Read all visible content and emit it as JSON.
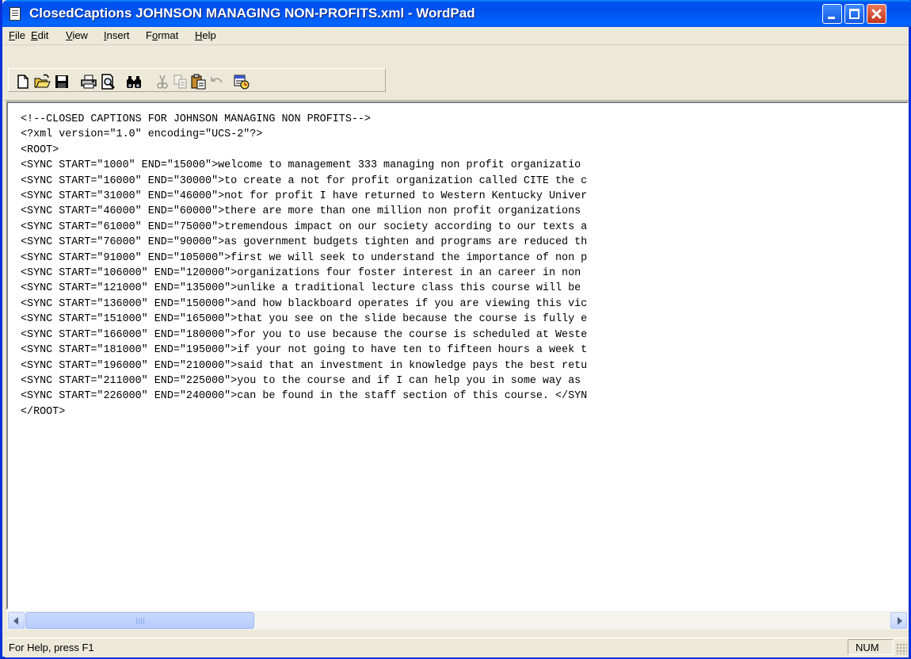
{
  "window": {
    "title": "ClosedCaptions JOHNSON MANAGING NON-PROFITS.xml - WordPad",
    "app_icon": "wordpad-document-icon",
    "controls": [
      "minimize-icon",
      "maximize-icon",
      "close-icon"
    ]
  },
  "menu": {
    "items": [
      {
        "accel": "F",
        "rest": "ile"
      },
      {
        "accel": "E",
        "rest": "dit"
      },
      {
        "accel": "V",
        "rest": "iew"
      },
      {
        "accel": "I",
        "rest": "nsert"
      },
      {
        "pre": "F",
        "accel": "o",
        "rest": "rmat"
      },
      {
        "accel": "H",
        "rest": "elp"
      }
    ]
  },
  "toolbar": {
    "buttons": [
      "new-icon",
      "open-icon",
      "save-icon",
      "print-icon",
      "print-preview-icon",
      "find-icon",
      "cut-icon",
      "copy-icon",
      "paste-icon",
      "undo-icon",
      "date-time-icon"
    ]
  },
  "document": {
    "lines": [
      "<!--CLOSED CAPTIONS FOR JOHNSON MANAGING NON PROFITS-->",
      "<?xml version=\"1.0\" encoding=\"UCS-2\"?>",
      "<ROOT>",
      "<SYNC START=\"1000\" END=\"15000\">welcome to management 333 managing non profit organizatio",
      "<SYNC START=\"16000\" END=\"30000\">to create a not for profit organization called CITE the c",
      "<SYNC START=\"31000\" END=\"46000\">not for profit I have returned to Western Kentucky Univer",
      "<SYNC START=\"46000\" END=\"60000\">there are more than one million non profit organizations",
      "<SYNC START=\"61000\" END=\"75000\">tremendous impact on our society according to our texts a",
      "<SYNC START=\"76000\" END=\"90000\">as government budgets tighten and programs are reduced th",
      "<SYNC START=\"91000\" END=\"105000\">first we will seek to understand the importance of non p",
      "<SYNC START=\"106000\" END=\"120000\">organizations four foster interest in an career in non",
      "<SYNC START=\"121000\" END=\"135000\">unlike a traditional lecture class this course will be",
      "<SYNC START=\"136000\" END=\"150000\">and how blackboard operates if you are viewing this vic",
      "<SYNC START=\"151000\" END=\"165000\">that you see on the slide because the course is fully e",
      "<SYNC START=\"166000\" END=\"180000\">for you to use because the course is scheduled at Weste",
      "<SYNC START=\"181000\" END=\"195000\">if your not going to have ten to fifteen hours a week t",
      "<SYNC START=\"196000\" END=\"210000\">said that an investment in knowledge pays the best retu",
      "<SYNC START=\"211000\" END=\"225000\">you to the course and if I can help you in some way as",
      "<SYNC START=\"226000\" END=\"240000\">can be found in the staff section of this course. </SYN",
      "</ROOT>"
    ]
  },
  "status": {
    "help_text": "For Help, press F1",
    "num_lock": "NUM"
  },
  "colors": {
    "titlebar": "#0053ee",
    "close_button": "#c2341b",
    "chrome": "#ece9d8"
  }
}
